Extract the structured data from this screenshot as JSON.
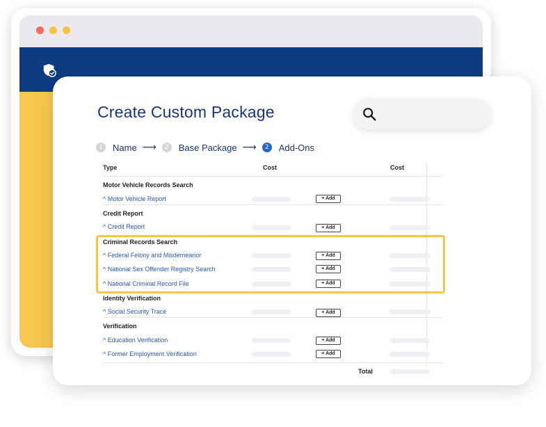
{
  "page": {
    "title": "Create Custom Package",
    "search_placeholder": ""
  },
  "stepper": {
    "steps": [
      {
        "number": "1",
        "label": "Name",
        "state": "done"
      },
      {
        "number": "2",
        "label": "Base Package",
        "state": "done"
      },
      {
        "number": "2",
        "label": "Add-Ons",
        "state": "active"
      }
    ],
    "separator": "⟶"
  },
  "table": {
    "headers": {
      "type": "Type",
      "cost1": "Cost",
      "cost2": "Cost"
    },
    "add_label": "+ Add",
    "total_label": "Total",
    "categories": [
      {
        "name": "Motor Vehicle Records Search",
        "items": [
          "^ Motor Vehicle Report"
        ]
      },
      {
        "name": "Credit Report",
        "items": [
          "^ Credit Report"
        ]
      },
      {
        "name": "Criminal Records Search",
        "items": [
          "^ Federal Felony and Misdemeanor",
          "^ National Sex Offender Registry Search",
          "^ National Criminal Record File"
        ]
      },
      {
        "name": "Identity Verification",
        "items": [
          "^ Social Security Trace"
        ]
      },
      {
        "name": "Verification",
        "items": [
          "^ Education Verification",
          "^ Former Employment Verification"
        ]
      }
    ]
  },
  "colors": {
    "brand_navy": "#0e3b82",
    "accent_yellow": "#f9c74f",
    "link_blue": "#2458b5",
    "highlight": "#f6c54a"
  },
  "icons": {
    "app_logo": "shield-check-icon",
    "search": "search-icon"
  }
}
